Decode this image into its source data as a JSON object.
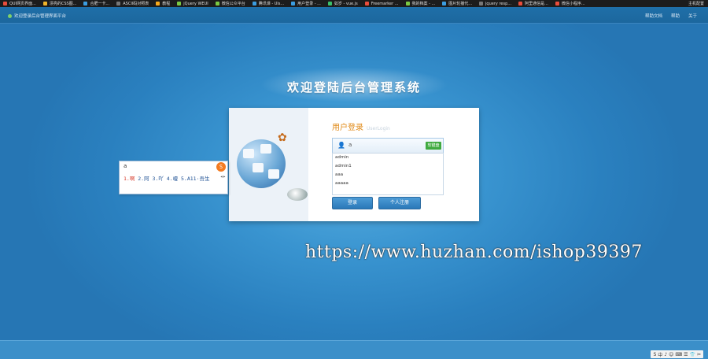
{
  "bookmarks": [
    {
      "label": "QUI网页界面...",
      "color": "#e94d3c"
    },
    {
      "label": "漂亮的CSS图...",
      "color": "#f0b429"
    },
    {
      "label": "合肥一卡...",
      "color": "#3c9de0"
    },
    {
      "label": "ASCII码对照表",
      "color": "#777"
    },
    {
      "label": "教程",
      "color": "#f7a91b"
    },
    {
      "label": "jQuery WEUI",
      "color": "#7ac943"
    },
    {
      "label": "微信公众平台",
      "color": "#7ac943"
    },
    {
      "label": "腾讯课 - Uls...",
      "color": "#3c9de0"
    },
    {
      "label": "用户登录 - ...",
      "color": "#3c9de0"
    },
    {
      "label": "如岁 - vue.js",
      "color": "#3cbf6a"
    },
    {
      "label": "Freemarker ...",
      "color": "#e94d3c"
    },
    {
      "label": "我的档案 - ...",
      "color": "#7ac943"
    },
    {
      "label": "图片轮播代...",
      "color": "#3c9de0"
    },
    {
      "label": "jquery resp...",
      "color": "#777"
    },
    {
      "label": "阿里通信是...",
      "color": "#e94d3c"
    },
    {
      "label": "微信小程序...",
      "color": "#e94d3c"
    }
  ],
  "bookmarks_right": "主机配置",
  "topbar": {
    "welcome": "欢迎登录后台管理界面平台",
    "links": [
      "帮助文档",
      "帮助",
      "关于"
    ]
  },
  "main_title": "欢迎登陆后台管理系统",
  "login": {
    "heading_cn": "用户登录",
    "heading_en": "UserLogin",
    "username_value": "a",
    "kb_label": "软键盘",
    "suggestions": [
      "admin",
      "admin1",
      "aaa",
      "aaaaa"
    ],
    "login_button": "登录",
    "register_button": "个人注册"
  },
  "ime": {
    "pinyin": "a",
    "candidates": [
      "1.啊",
      "2.阿",
      "3.吖",
      "4.嗄",
      "5.A11·吾生"
    ],
    "nav": "◂▸",
    "logo": "S"
  },
  "watermark": "https://www.huzhan.com/ishop39397",
  "tray": [
    "S",
    "中",
    "♪",
    "☺",
    "⌨",
    "☰",
    "👕",
    "✂"
  ]
}
